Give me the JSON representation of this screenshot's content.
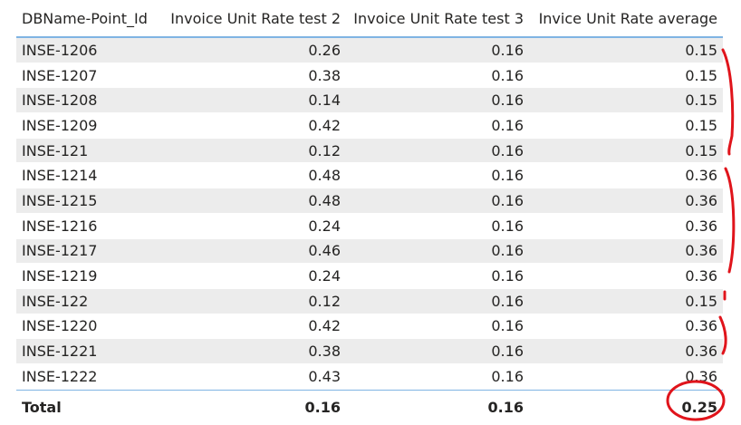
{
  "table": {
    "columns": [
      "DBName-Point_Id",
      "Invoice Unit Rate test 2",
      "Invoice Unit Rate test 3",
      "Invice Unit Rate average"
    ],
    "rows": [
      [
        "INSE-1206",
        "0.26",
        "0.16",
        "0.15"
      ],
      [
        "INSE-1207",
        "0.38",
        "0.16",
        "0.15"
      ],
      [
        "INSE-1208",
        "0.14",
        "0.16",
        "0.15"
      ],
      [
        "INSE-1209",
        "0.42",
        "0.16",
        "0.15"
      ],
      [
        "INSE-121",
        "0.12",
        "0.16",
        "0.15"
      ],
      [
        "INSE-1214",
        "0.48",
        "0.16",
        "0.36"
      ],
      [
        "INSE-1215",
        "0.48",
        "0.16",
        "0.36"
      ],
      [
        "INSE-1216",
        "0.24",
        "0.16",
        "0.36"
      ],
      [
        "INSE-1217",
        "0.46",
        "0.16",
        "0.36"
      ],
      [
        "INSE-1219",
        "0.24",
        "0.16",
        "0.36"
      ],
      [
        "INSE-122",
        "0.12",
        "0.16",
        "0.15"
      ],
      [
        "INSE-1220",
        "0.42",
        "0.16",
        "0.36"
      ],
      [
        "INSE-1221",
        "0.38",
        "0.16",
        "0.36"
      ],
      [
        "INSE-1222",
        "0.43",
        "0.16",
        "0.36"
      ]
    ],
    "total": [
      "Total",
      "0.16",
      "0.16",
      "0.25"
    ]
  },
  "colors": {
    "header_border": "#7fb4e3",
    "row_shade": "#ececec",
    "annotation": "#e0141b"
  }
}
